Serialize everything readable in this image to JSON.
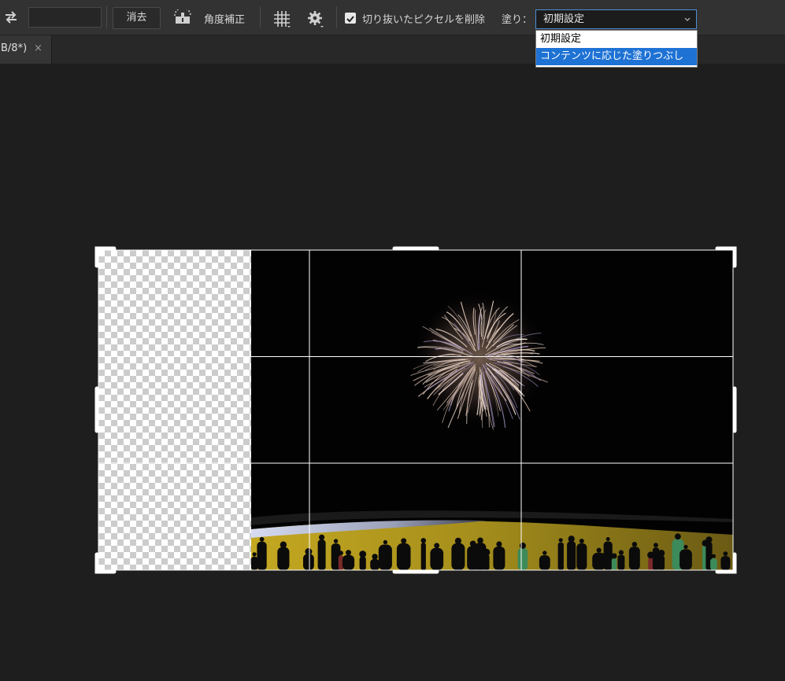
{
  "options_bar": {
    "ratio_value": "",
    "clear_label": "消去",
    "straighten_label": "角度補正",
    "delete_cropped_checked": true,
    "delete_cropped_label": "切り抜いたピクセルを削除",
    "fill_label": "塗り：",
    "fill_selected": "初期設定",
    "icons": [
      "swap-icon",
      "straighten-icon",
      "grid-overlay-icon",
      "gear-icon",
      "chevron-down-icon"
    ]
  },
  "fill_dropdown": {
    "options": [
      "初期設定",
      "コンテンツに応じた塗りつぶし"
    ],
    "highlighted_index": 1
  },
  "document_tab": {
    "label": "B/8*)",
    "close_glyph": "×"
  },
  "colors": {
    "accent": "#1e72d4",
    "select_border": "#4d8fd6",
    "panel": "#323232",
    "canvas": "#1e1e1e"
  }
}
